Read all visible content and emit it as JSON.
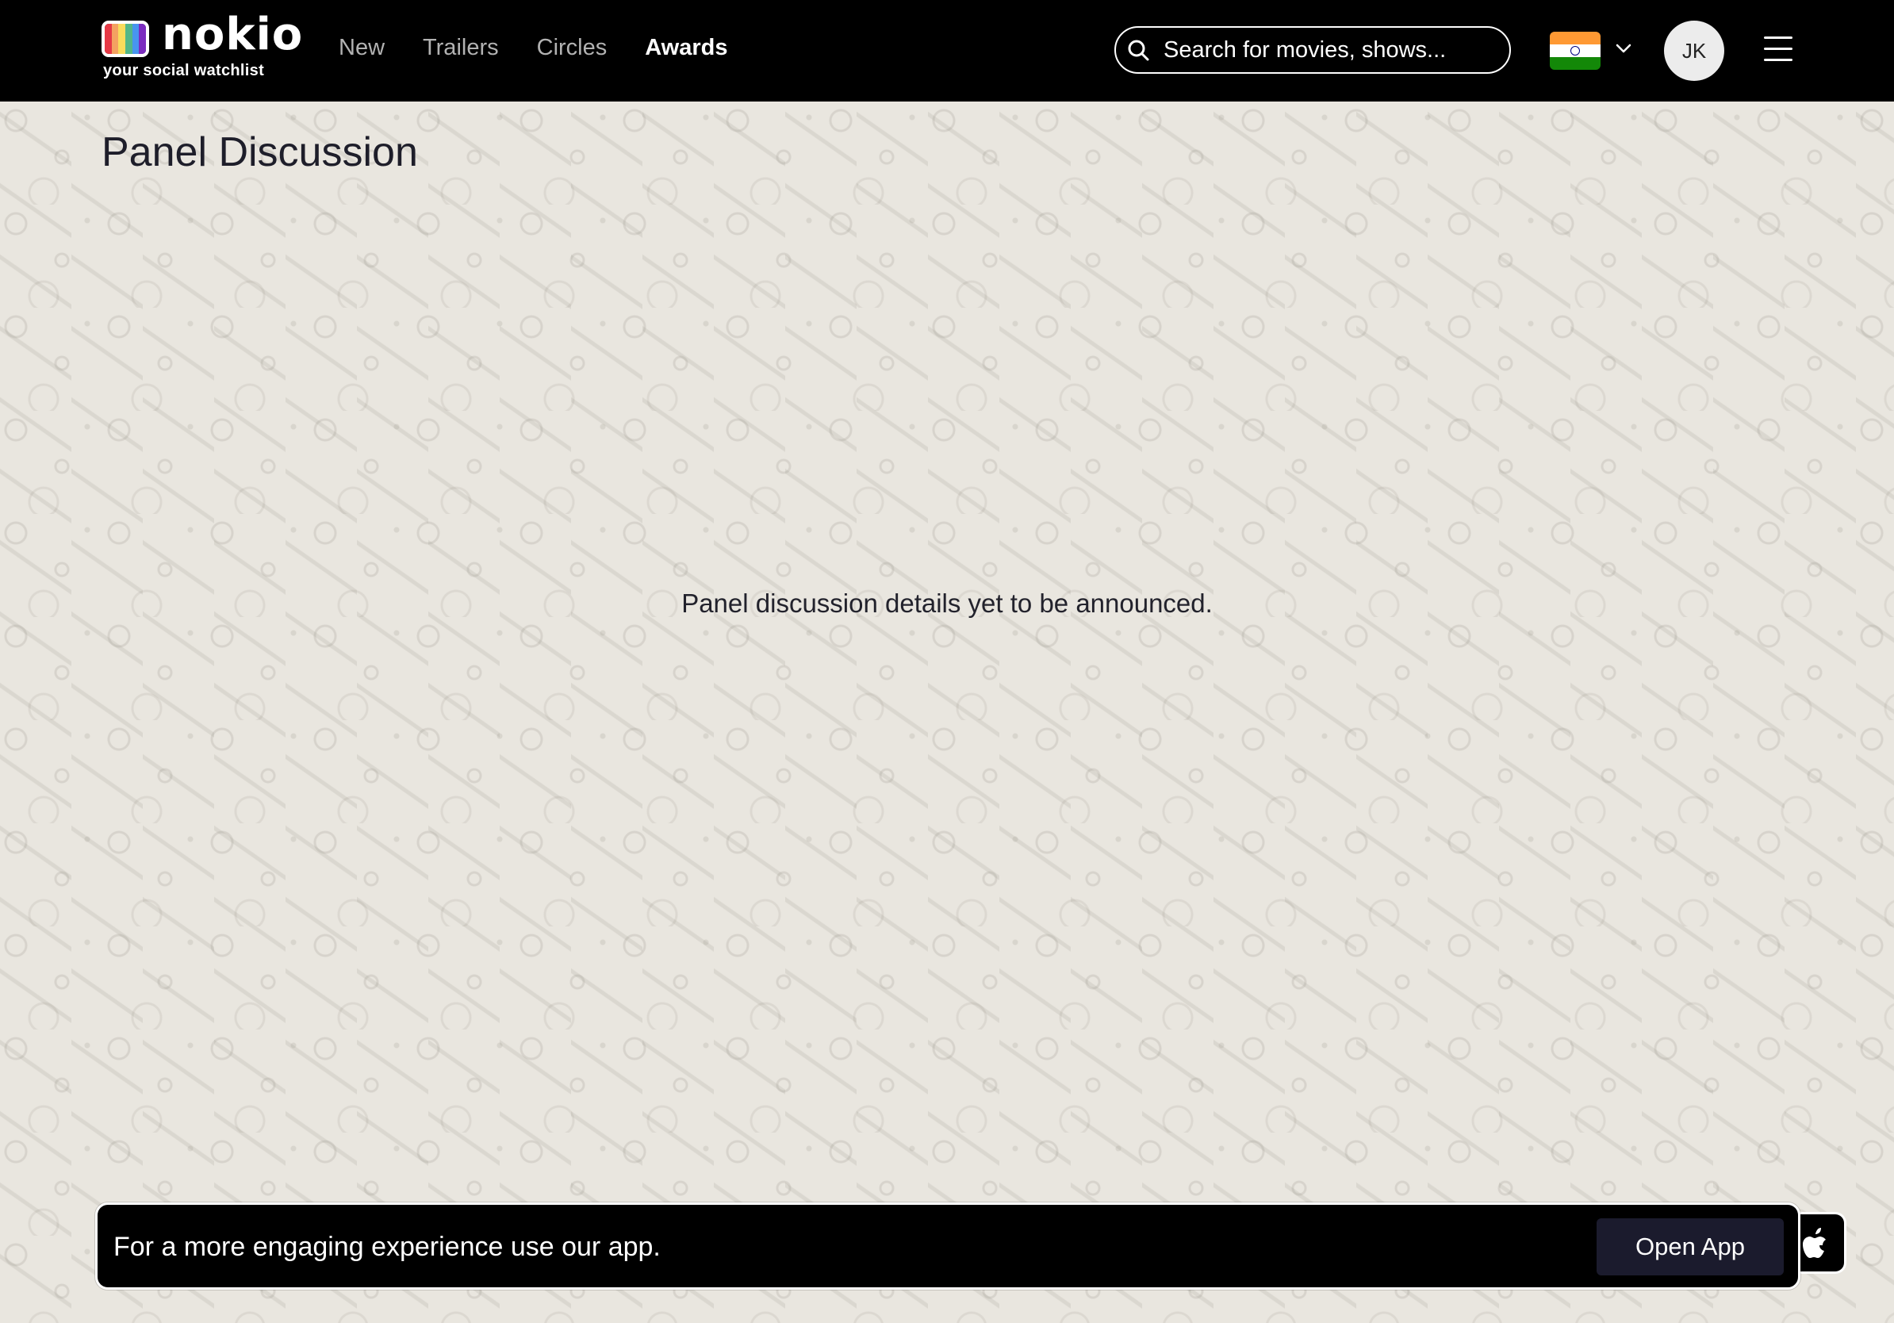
{
  "header": {
    "logo": {
      "wordmark": "nokio",
      "tagline": "your social watchlist"
    },
    "nav": [
      {
        "label": "New",
        "active": false
      },
      {
        "label": "Trailers",
        "active": false
      },
      {
        "label": "Circles",
        "active": false
      },
      {
        "label": "Awards",
        "active": true
      }
    ],
    "search": {
      "placeholder": "Search for movies, shows...",
      "value": ""
    },
    "region": {
      "flag": "india-flag-icon"
    },
    "user": {
      "initials": "JK"
    }
  },
  "main": {
    "title": "Panel Discussion",
    "message": "Panel discussion details yet to be announced."
  },
  "app_banner": {
    "text": "For a more engaging experience use our app.",
    "button_label": "Open App",
    "platform_icon": "apple-icon"
  },
  "colors": {
    "header_bg": "#000000",
    "page_bg": "#e9e6df",
    "nav_inactive": "#b2b2b2",
    "nav_active": "#ffffff",
    "button_bg": "#1b1b2d"
  }
}
